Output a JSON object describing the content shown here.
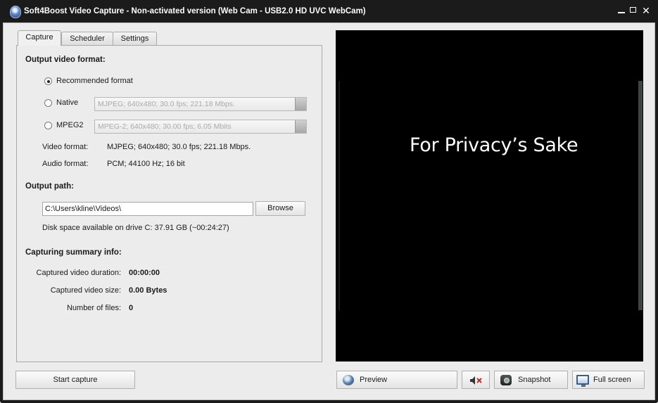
{
  "window": {
    "title": "Soft4Boost Video Capture - Non-activated version (Web Cam - USB2.0 HD UVC WebCam)",
    "controls": {
      "minimize": "–",
      "maximize": "□",
      "close": "✕"
    }
  },
  "tabs": [
    {
      "label": "Capture",
      "active": true
    },
    {
      "label": "Scheduler",
      "active": false
    },
    {
      "label": "Settings",
      "active": false
    }
  ],
  "output_format": {
    "title": "Output video format:",
    "options": [
      {
        "label": "Recommended format",
        "selected": true
      },
      {
        "label": "Native",
        "selected": false,
        "combo_value": "MJPEG; 640x480; 30.0 fps; 221.18 Mbps."
      },
      {
        "label": "MPEG2",
        "selected": false,
        "combo_value": "MPEG-2; 640x480; 30.00 fps; 6.05 Mbits"
      }
    ],
    "video_format_label": "Video format:",
    "video_format_value": "MJPEG; 640x480; 30.0 fps; 221.18 Mbps.",
    "audio_format_label": "Audio format:",
    "audio_format_value": "PCM; 44100 Hz; 16 bit"
  },
  "output_path": {
    "title": "Output path:",
    "value": "C:\\Users\\kline\\Videos\\",
    "browse_label": "Browse",
    "disk_space": "Disk space available on drive C: 37.91 GB (~00:24:27)"
  },
  "summary": {
    "title": "Capturing summary info:",
    "duration_label": "Captured video duration:",
    "duration_value": "00:00:00",
    "size_label": "Captured video size:",
    "size_value": "0.00 Bytes",
    "files_label": "Number of files:",
    "files_value": "0"
  },
  "preview": {
    "overlay_text": "For Privacy’s Sake"
  },
  "buttons": {
    "start_capture": "Start capture",
    "preview": "Preview",
    "snapshot": "Snapshot",
    "full_screen": "Full screen"
  },
  "icons": {
    "app": "app-icon",
    "preview": "webcam-globe-icon",
    "mute": "speaker-mute-icon",
    "snapshot": "camera-icon",
    "full_screen": "monitor-icon"
  }
}
